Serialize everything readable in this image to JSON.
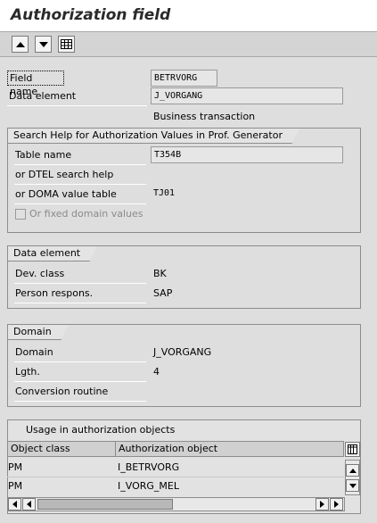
{
  "window": {
    "title": "Authorization field"
  },
  "toolbar": {
    "icons": [
      "up-arrow-icon",
      "down-arrow-icon",
      "table-icon"
    ]
  },
  "header": {
    "field_name_label": "Field name",
    "field_name_value": "BETRVORG",
    "data_element_label": "Data element",
    "data_element_value": "J_VORGANG",
    "data_element_desc": "Business transaction"
  },
  "search_help": {
    "title": "Search Help for Authorization Values in Prof. Generator",
    "table_name_label": "Table name",
    "table_name_value": "T354B",
    "dtel_label": "or DTEL search help",
    "dtel_value": "",
    "doma_label": "or DOMA value table",
    "doma_value": "TJ01",
    "fixed_label": "Or fixed domain values"
  },
  "data_element_group": {
    "title": "Data element",
    "dev_class_label": "Dev. class",
    "dev_class_value": "BK",
    "person_label": "Person respons.",
    "person_value": "SAP"
  },
  "domain_group": {
    "title": "Domain",
    "domain_label": "Domain",
    "domain_value": "J_VORGANG",
    "length_label": "Lgth.",
    "length_value": "4",
    "conversion_label": "Conversion routine",
    "conversion_value": ""
  },
  "usage": {
    "title": "Usage in authorization objects",
    "columns": [
      "Object class",
      "Authorization object"
    ],
    "rows": [
      [
        "PM",
        "I_BETRVORG"
      ],
      [
        "PM",
        "I_VORG_MEL"
      ]
    ]
  }
}
